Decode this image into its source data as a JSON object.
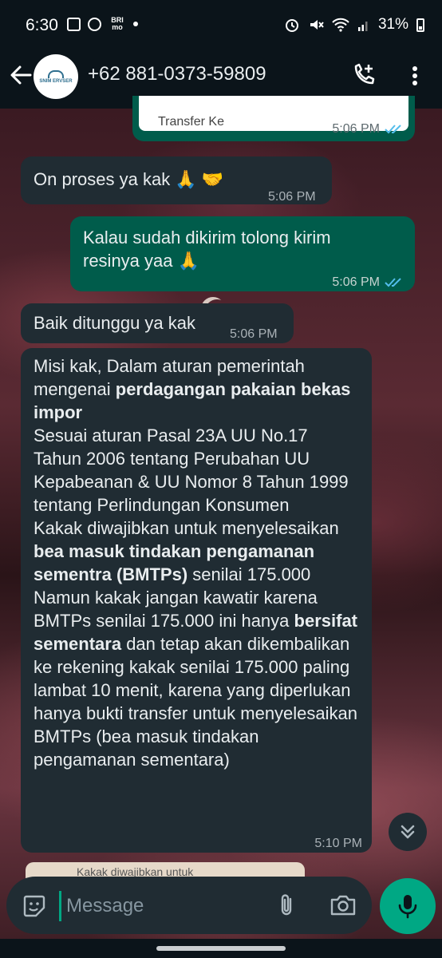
{
  "status_bar": {
    "time": "6:30",
    "battery": "31%",
    "bank_badge": "BRI mo"
  },
  "header": {
    "contact_name": "+62 881-0373-59809",
    "avatar_label": "SNIM ERVSER"
  },
  "messages": [
    {
      "dir": "out",
      "card_label": "Transfer Ke",
      "time": "5:06 PM"
    },
    {
      "dir": "in",
      "text": "On proses ya kak 🙏 🤝",
      "time": "5:06 PM"
    },
    {
      "dir": "out",
      "text": "Kalau sudah dikirim tolong kirim resinya yaa 🙏",
      "time": "5:06 PM"
    },
    {
      "dir": "in",
      "text": "Baik ditunggu ya kak",
      "time": "5:06 PM"
    },
    {
      "dir": "in",
      "time": "5:10 PM",
      "parts": {
        "p1": "Misi kak, Dalam aturan pemerintah mengenai ",
        "p1_bold": "perdagangan pakaian bekas impor",
        "p2": "Sesuai aturan Pasal 23A UU No.17 Tahun 2006 tentang Perubahan UU Kepabeanan & UU Nomor 8 Tahun 1999 tentang Perlindungan Konsumen",
        "p3": "Kakak diwajibkan untuk menyelesaikan ",
        "p3_bold": "bea masuk tindakan pengamanan sementra (BMTPs)",
        "p3_end": " senilai 175.000",
        "p4": "Namun kakak jangan kawatir karena BMTPs senilai 175.000 ini hanya ",
        "p4_bold": "bersifat sementara",
        "p4_end": " dan tetap akan dikembalikan ke rekening kakak senilai 175.000 paling lambat 10 menit, karena yang diperlukan hanya bukti transfer untuk menyelesaikan BMTPs (bea masuk tindakan pengamanan sementara)"
      }
    },
    {
      "dir": "in",
      "quote_preview": "Kakak diwajibkan untuk"
    }
  ],
  "composer": {
    "placeholder": "Message"
  },
  "colors": {
    "incoming_bubble": "#202c33",
    "outgoing_bubble": "#005c4b",
    "accent": "#00a884",
    "read_ticks": "#53bdeb"
  }
}
